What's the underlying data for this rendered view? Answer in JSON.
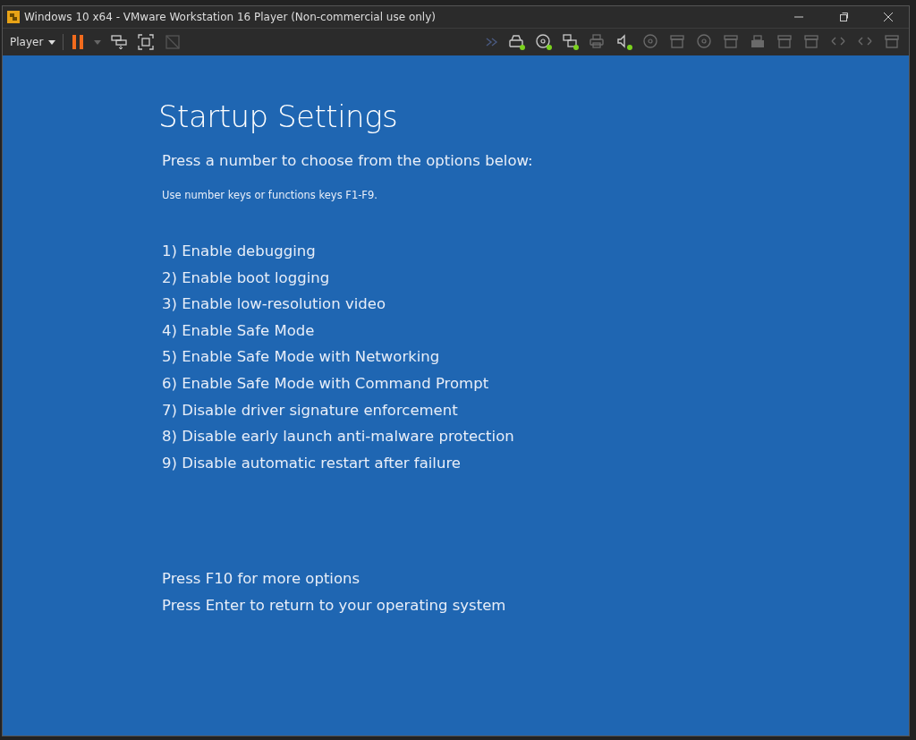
{
  "window": {
    "title": "Windows 10 x64 - VMware Workstation 16 Player (Non-commercial use only)"
  },
  "toolbar": {
    "menu": "Player",
    "paused": true,
    "devices": [
      {
        "kind": "hdd",
        "connected": true
      },
      {
        "kind": "cd",
        "connected": true
      },
      {
        "kind": "network",
        "connected": true
      },
      {
        "kind": "printer",
        "connected": false
      },
      {
        "kind": "sound",
        "connected": true
      },
      {
        "kind": "cd",
        "connected": false
      },
      {
        "kind": "box",
        "connected": false
      },
      {
        "kind": "cd",
        "connected": false
      },
      {
        "kind": "box",
        "connected": false
      },
      {
        "kind": "usb",
        "connected": false
      },
      {
        "kind": "box",
        "connected": false
      },
      {
        "kind": "box",
        "connected": false
      },
      {
        "kind": "arrows",
        "connected": false
      },
      {
        "kind": "arrows",
        "connected": false
      },
      {
        "kind": "box",
        "connected": false
      }
    ]
  },
  "screen": {
    "title": "Startup Settings",
    "subtitle": "Press a number to choose from the options below:",
    "hint": "Use number keys or functions keys F1-F9.",
    "options": [
      "1) Enable debugging",
      "2) Enable boot logging",
      "3) Enable low-resolution video",
      "4) Enable Safe Mode",
      "5) Enable Safe Mode with Networking",
      "6) Enable Safe Mode with Command Prompt",
      "7) Disable driver signature enforcement",
      "8) Disable early launch anti-malware protection",
      "9) Disable automatic restart after failure"
    ],
    "footer": [
      "Press F10 for more options",
      "Press Enter to return to your operating system"
    ]
  }
}
